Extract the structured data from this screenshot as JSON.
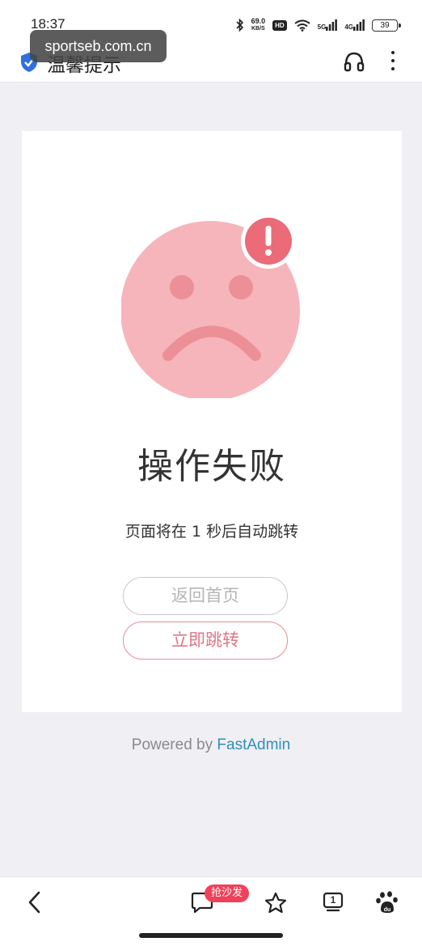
{
  "status_bar": {
    "time": "18:37",
    "net_speed_value": "69.0",
    "net_speed_unit": "KB/S",
    "hd_label": "HD",
    "signal_5g": "5G",
    "signal_4g": "4G",
    "battery": "39"
  },
  "watermark": "sportseb.com.cn",
  "title_bar": {
    "title": "温馨提示"
  },
  "main": {
    "heading": "操作失败",
    "redirect_text": "页面将在 1 秒后自动跳转",
    "home_button": "返回首页",
    "jump_button": "立即跳转"
  },
  "footer": {
    "powered_prefix": "Powered by ",
    "powered_brand": "FastAdmin"
  },
  "bottom_nav": {
    "badge": "抢沙发",
    "tabs_count": "1"
  },
  "colors": {
    "face": "#f5b5ba",
    "face_features": "#ec8f97",
    "alert": "#eb6b78",
    "brand_link": "#2f8fb9",
    "badge": "#f0415a"
  }
}
